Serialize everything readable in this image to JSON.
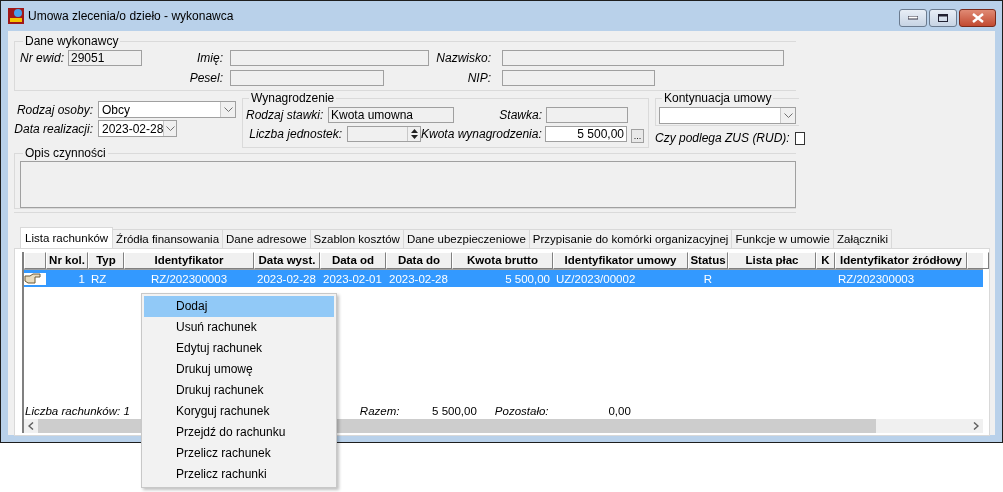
{
  "window": {
    "title": "Umowa zlecenia/o dzieło - wykonawca"
  },
  "contractor": {
    "legend": "Dane wykonawcy",
    "nr_ewid": {
      "label": "Nr ewid:",
      "value": "29051"
    },
    "first_name": {
      "label": "Imię:"
    },
    "last_name": {
      "label": "Nazwisko:"
    },
    "pesel": {
      "label": "Pesel:"
    },
    "nip": {
      "label": "NIP:"
    }
  },
  "person_type": {
    "label": "Rodzaj osoby:",
    "value": "Obcy"
  },
  "realization_date": {
    "label": "Data realizacji:",
    "value": "2023-02-28"
  },
  "remuneration": {
    "legend": "Wynagrodzenie",
    "rate_type": {
      "label": "Rodzaj stawki:",
      "value": "Kwota umowna"
    },
    "rate": {
      "label": "Stawka:"
    },
    "units": {
      "label": "Liczba jednostek:"
    },
    "amount": {
      "label": "Kwota wynagrodzenia:",
      "value": "5 500,00"
    },
    "picker_button": "..."
  },
  "continuation": {
    "legend": "Kontynuacja umowy"
  },
  "zus": {
    "label": "Czy podlega ZUS (RUD):",
    "checked": false
  },
  "description": {
    "legend": "Opis czynności"
  },
  "tabs": [
    {
      "label": "Lista rachunków",
      "selected": true
    },
    {
      "label": "Źródła finansowania",
      "selected": false
    },
    {
      "label": "Dane adresowe",
      "selected": false
    },
    {
      "label": "Szablon kosztów",
      "selected": false
    },
    {
      "label": "Dane ubezpieczeniowe",
      "selected": false
    },
    {
      "label": "Przypisanie do komórki organizacyjnej",
      "selected": false
    },
    {
      "label": "Funkcje w umowie",
      "selected": false
    },
    {
      "label": "Załączniki",
      "selected": false
    }
  ],
  "table": {
    "columns": [
      "Nr kol.",
      "Typ",
      "Identyfikator",
      "Data wyst.",
      "Data od",
      "Data do",
      "Kwota brutto",
      "Identyfikator umowy",
      "Status",
      "Lista płac",
      "K",
      "Identyfikator źródłowy"
    ],
    "rows": [
      {
        "selected": true,
        "cells": [
          "1",
          "RZ",
          "RZ/202300003",
          "2023-02-28",
          "2023-02-01",
          "2023-02-28",
          "5 500,00",
          "UZ/2023/00002",
          "R",
          null,
          null,
          "RZ/202300003"
        ]
      }
    ]
  },
  "summary": {
    "count": "Liczba rachunków: 1",
    "total_label": "Razem:",
    "total": "5 500,00",
    "remaining_label": "Pozostało:",
    "remaining": "0,00"
  },
  "context_menu": {
    "items": [
      {
        "label": "Dodaj",
        "selected": true
      },
      {
        "label": "Usuń rachunek",
        "selected": false
      },
      {
        "label": "Edytuj rachunek",
        "selected": false
      },
      {
        "label": "Drukuj umowę",
        "selected": false
      },
      {
        "label": "Drukuj rachunek",
        "selected": false
      },
      {
        "label": "Koryguj rachunek",
        "selected": false
      },
      {
        "label": "Przejdź do rachunku",
        "selected": false
      },
      {
        "label": "Przelicz rachunek",
        "selected": false
      },
      {
        "label": "Przelicz rachunki",
        "selected": false
      }
    ]
  }
}
